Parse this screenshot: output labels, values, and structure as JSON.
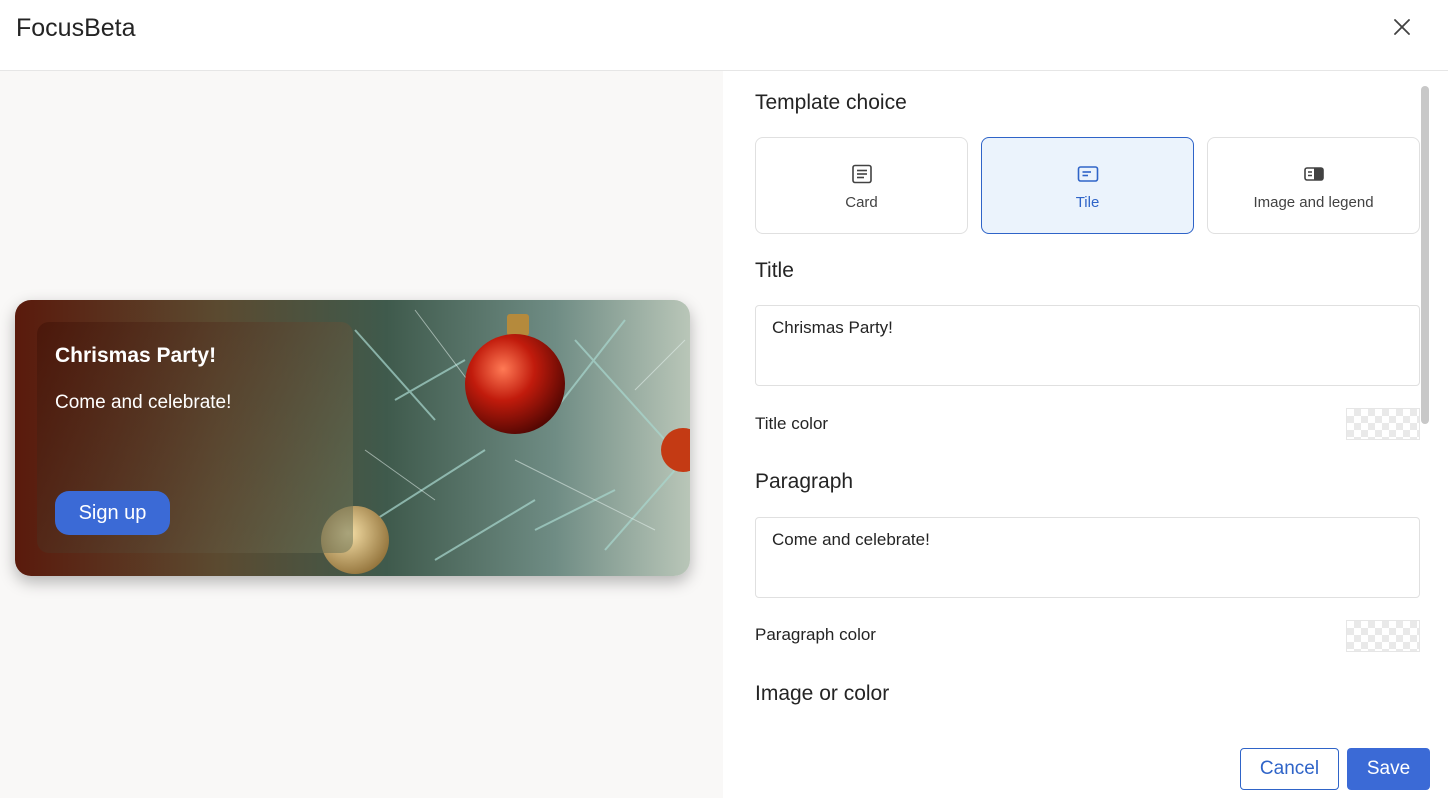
{
  "header": {
    "app_title": "FocusBeta",
    "close_icon": "close-icon"
  },
  "preview": {
    "title": "Chrismas Party!",
    "paragraph": "Come and celebrate!",
    "button_label": "Sign up",
    "button_color": "#3b6ad6"
  },
  "settings": {
    "template_heading": "Template choice",
    "templates": [
      {
        "label": "Card",
        "icon": "card-template-icon",
        "selected": false
      },
      {
        "label": "Tile",
        "icon": "tile-template-icon",
        "selected": true
      },
      {
        "label": "Image and legend",
        "icon": "image-legend-template-icon",
        "selected": false
      }
    ],
    "title_heading": "Title",
    "title_value": "Chrismas Party!",
    "title_color_label": "Title color",
    "paragraph_heading": "Paragraph",
    "paragraph_value": "Come and celebrate!",
    "paragraph_color_label": "Paragraph color",
    "image_heading": "Image or color"
  },
  "actions": {
    "cancel_label": "Cancel",
    "save_label": "Save"
  },
  "colors": {
    "accent": "#2f64c8",
    "selected_bg": "#ebf3fc"
  }
}
